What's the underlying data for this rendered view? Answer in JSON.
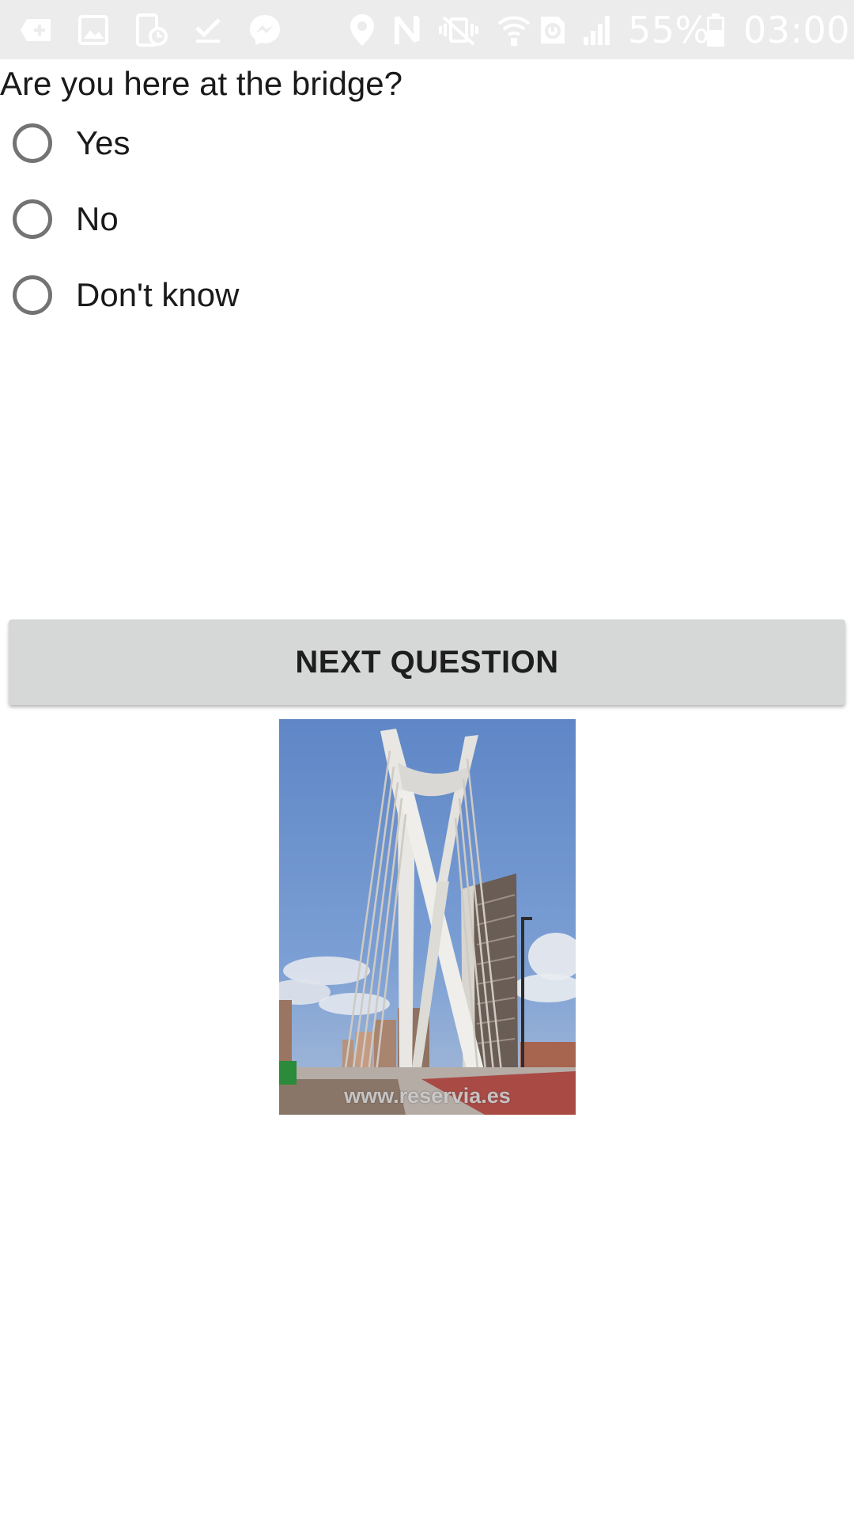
{
  "status_bar": {
    "icons": [
      "add-icon",
      "image-icon",
      "device-schedule-icon",
      "check-icon",
      "messenger-icon",
      "location-icon",
      "nfc-icon",
      "vibrate-icon",
      "wifi-icon",
      "data-saver-icon",
      "signal-icon",
      "battery-icon"
    ],
    "battery": "55%",
    "time": "03:00",
    "background_color": "#ececec"
  },
  "survey": {
    "question": "Are you here at the bridge?",
    "options": [
      {
        "label": "Yes",
        "selected": false
      },
      {
        "label": "No",
        "selected": false
      },
      {
        "label": "Don't know",
        "selected": false
      }
    ],
    "next_button": "NEXT QUESTION"
  },
  "image": {
    "subject": "cable-stayed bridge pylon",
    "watermark": "www.reservia.es"
  },
  "colors": {
    "radio_border": "#737373",
    "button_bg": "#d6d7d7",
    "text": "#1a1a1a"
  }
}
